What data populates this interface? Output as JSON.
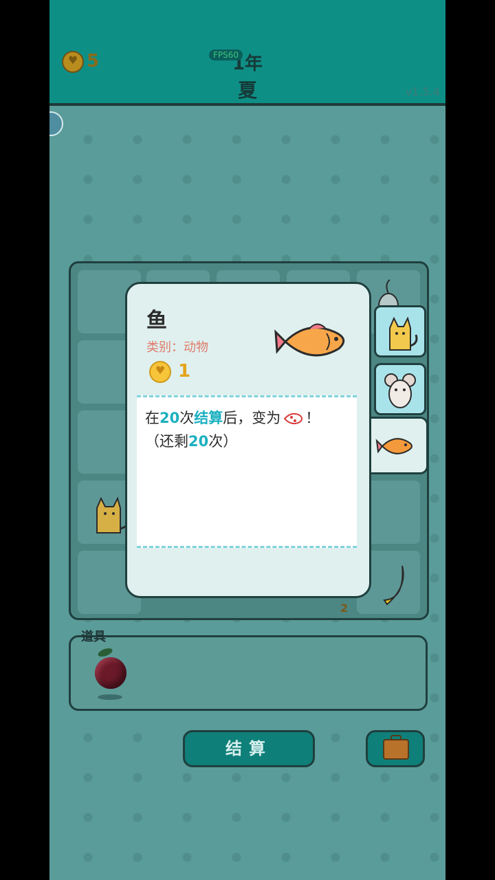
{
  "header": {
    "coins": "5",
    "fps": "FPS60",
    "year": "1年",
    "season": "夏",
    "version": "v1.5.4"
  },
  "board": {
    "cell_badge": "2"
  },
  "items": {
    "label": "道具"
  },
  "buttons": {
    "settle": "结算"
  },
  "popup": {
    "name": "鱼",
    "category": "类别：动物",
    "coin_value": "1",
    "desc_prefix": "在",
    "desc_count": "20",
    "desc_mid1": "次",
    "desc_settle": "结算",
    "desc_mid2": "后，变为",
    "desc_suffix": "！",
    "remain_prefix": "（还剩",
    "remain_count": "20",
    "remain_suffix": "次）"
  },
  "colors": {
    "header": "#0e8f86",
    "accent_text": "#1bb0c0",
    "category_text": "#e07b6a",
    "coin": "#f6c53a"
  }
}
